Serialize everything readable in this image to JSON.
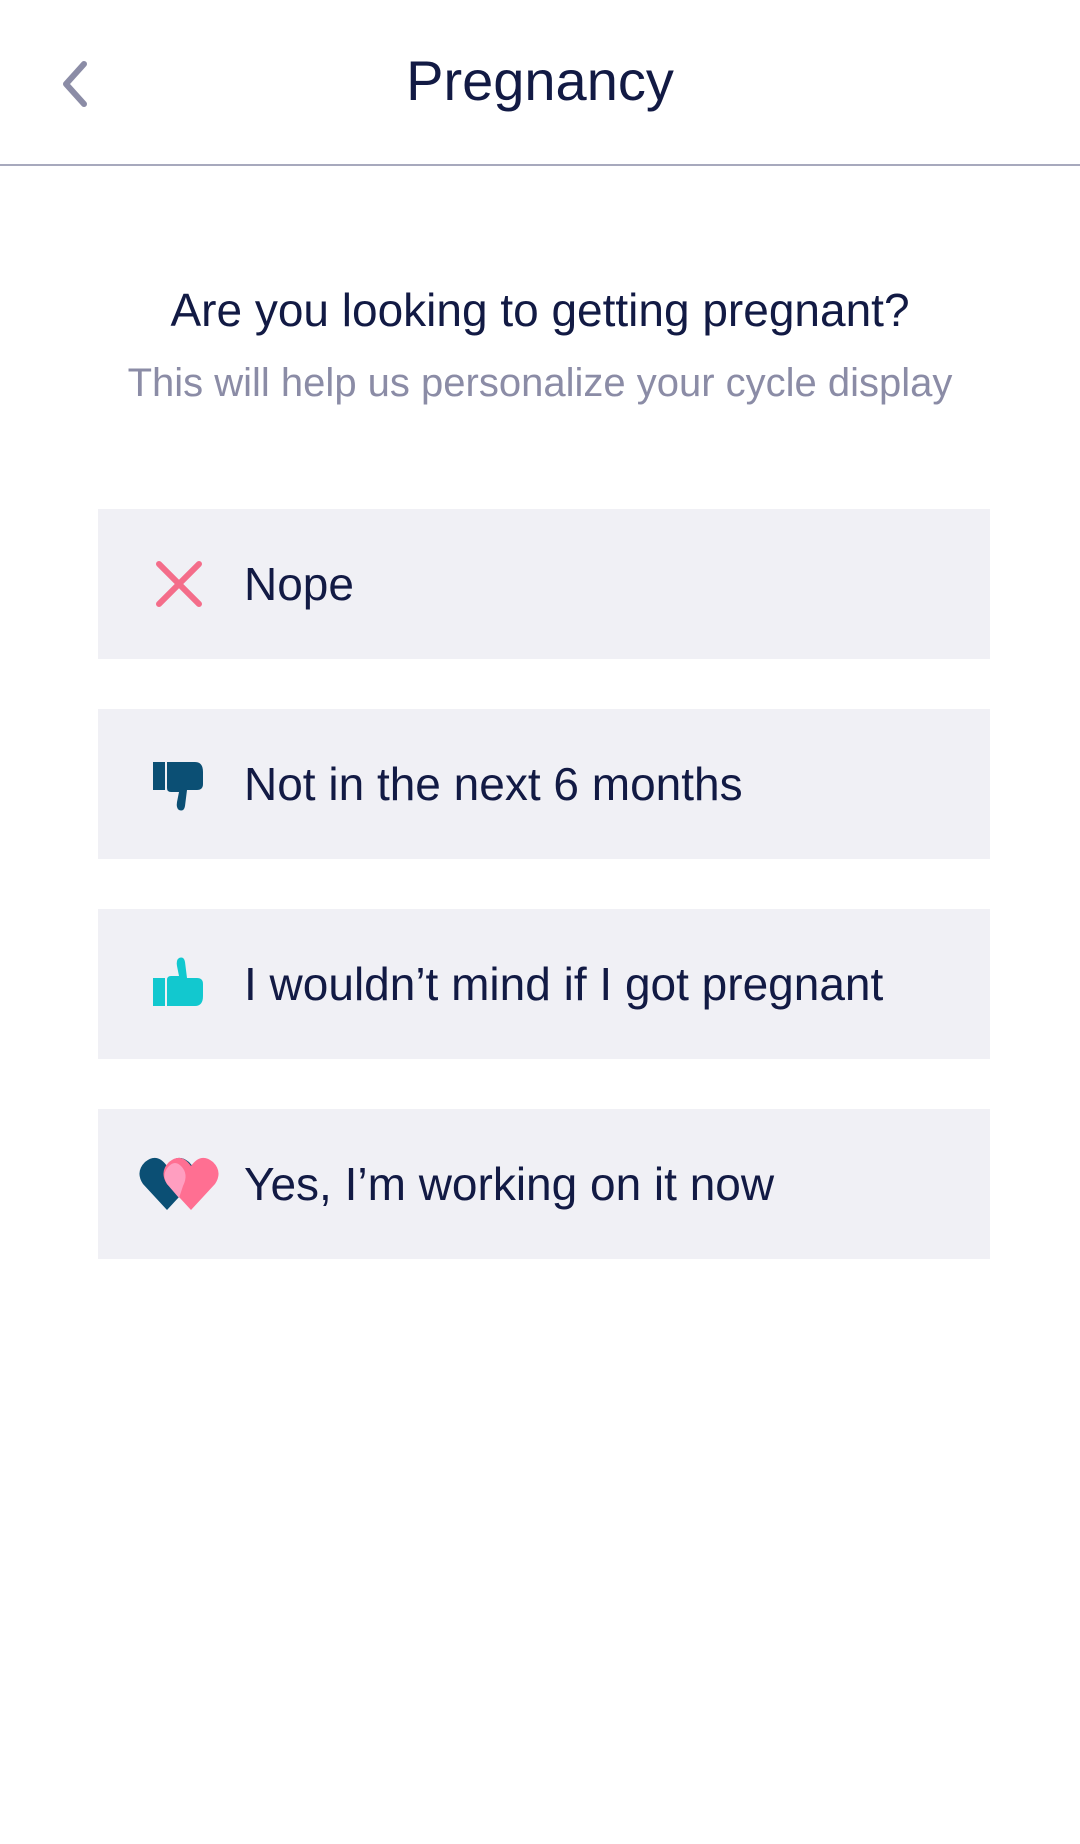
{
  "header": {
    "title": "Pregnancy",
    "back_icon": "chevron-left-icon"
  },
  "question": {
    "title": "Are you looking to getting pregnant?",
    "subtitle": "This will help us personalize your cycle display"
  },
  "options": [
    {
      "label": "Nope",
      "icon": "x-icon"
    },
    {
      "label": "Not in the next 6 months",
      "icon": "thumbs-down-icon"
    },
    {
      "label": "I wouldn’t mind if I got pregnant",
      "icon": "thumbs-up-icon"
    },
    {
      "label": "Yes, I’m working on it now",
      "icon": "two-hearts-icon"
    }
  ],
  "colors": {
    "text_primary": "#121a44",
    "text_secondary": "#8b8ca6",
    "option_bg": "#f0f0f5",
    "divider": "#a7a9bd",
    "x_pink": "#f46d8a",
    "thumb_dark": "#0b4f74",
    "thumb_teal": "#12c8cf",
    "heart_pink": "#ff6f92",
    "heart_light": "#ff9ec0"
  }
}
